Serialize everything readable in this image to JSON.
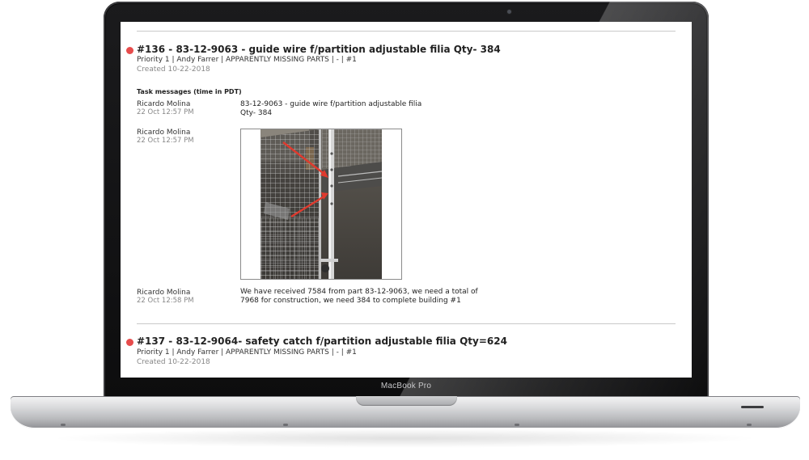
{
  "device": {
    "brand_label": "MacBook Pro"
  },
  "tasks": [
    {
      "title": "#136 - 83-12-9063 - guide wire f/partition adjustable filia Qty- 384",
      "meta": "Priority 1 | Andy Farrer | APPARENTLY MISSING PARTS | - | #1",
      "created": "Created 10-22-2018",
      "status_color": "#e74c4c"
    },
    {
      "title": "#137 - 83-12-9064- safety catch f/partition adjustable filia Qty=624",
      "meta": "Priority 1 | Andy Farrer | APPARENTLY MISSING PARTS | - | #1",
      "created": "Created 10-22-2018",
      "status_color": "#e74c4c"
    }
  ],
  "messages_header": "Task messages (time in PDT)",
  "messages": [
    {
      "author": "Ricardo  Molina",
      "time": "22 Oct 12:57 PM",
      "text_line1": "83-12-9063 - guide wire f/partition adjustable filia",
      "text_line2": "Qty- 384"
    },
    {
      "author": "Ricardo  Molina",
      "time": "22 Oct 12:57 PM",
      "attachment": "photo of wire partition with red arrows"
    },
    {
      "author": "Ricardo  Molina",
      "time": "22 Oct 12:58 PM",
      "text_line1": "We have received 7584  from part 83-12-9063, we need a total of",
      "text_line2": "7968 for construction, we need 384 to complete building #1"
    }
  ]
}
